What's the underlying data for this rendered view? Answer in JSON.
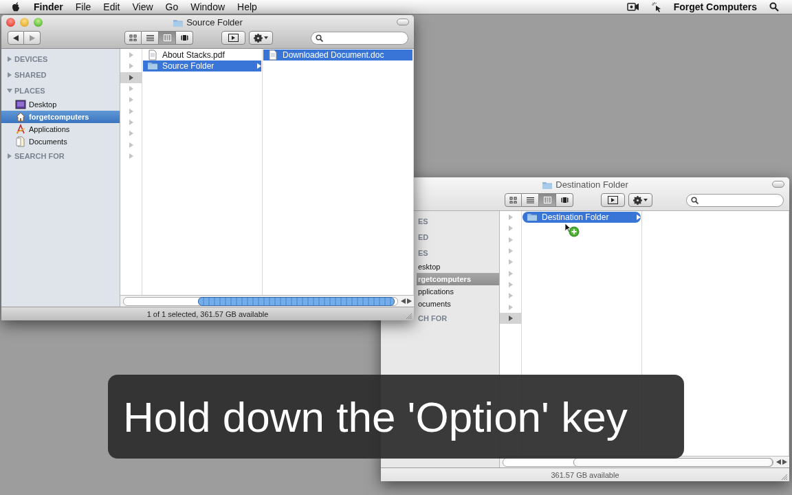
{
  "menu_bar": {
    "app": "Finder",
    "menus": [
      "File",
      "Edit",
      "View",
      "Go",
      "Window",
      "Help"
    ],
    "user": "Forget Computers"
  },
  "windows": [
    {
      "title": "Source Folder",
      "active": true,
      "window_controls": true,
      "sidebar": {
        "sections": [
          {
            "label": "DEVICES",
            "expanded": false
          },
          {
            "label": "SHARED",
            "expanded": false
          },
          {
            "label": "PLACES",
            "expanded": true,
            "items": [
              {
                "label": "Desktop",
                "selected": false
              },
              {
                "label": "forgetcomputers",
                "selected": true
              },
              {
                "label": "Applications",
                "selected": false
              },
              {
                "label": "Documents",
                "selected": false
              }
            ]
          },
          {
            "label": "SEARCH FOR",
            "expanded": false
          }
        ]
      },
      "arrow_column": [
        {
          "selected": false
        },
        {
          "selected": false
        },
        {
          "selected": true
        },
        {
          "selected": false
        },
        {
          "selected": false
        },
        {
          "selected": false
        },
        {
          "selected": false
        },
        {
          "selected": false
        },
        {
          "selected": false
        },
        {
          "selected": false
        }
      ],
      "columns": [
        {
          "items": [
            {
              "name": "About Stacks.pdf",
              "kind": "document",
              "selected": false
            },
            {
              "name": "Source Folder",
              "kind": "folder",
              "selected": true
            }
          ]
        },
        {
          "items": [
            {
              "name": "Downloaded Document.doc",
              "kind": "document",
              "selected": true
            }
          ]
        }
      ],
      "status": "1 of 1 selected, 361.57 GB available"
    },
    {
      "title": "Destination Folder",
      "active": false,
      "sidebar": {
        "partial": true,
        "sections": [
          {
            "label": "ES"
          },
          {
            "label": "ED"
          },
          {
            "label": "ES",
            "items": [
              {
                "label": "esktop",
                "selected": false
              },
              {
                "label": "rgetcomputers",
                "selected": true
              },
              {
                "label": "pplications",
                "selected": false
              },
              {
                "label": "ocuments",
                "selected": false
              }
            ]
          },
          {
            "label": "CH FOR"
          }
        ]
      },
      "arrow_column": [
        {
          "selected": false
        },
        {
          "selected": false
        },
        {
          "selected": false
        },
        {
          "selected": false
        },
        {
          "selected": false
        },
        {
          "selected": false
        },
        {
          "selected": false
        },
        {
          "selected": false
        },
        {
          "selected": false
        },
        {
          "selected": true
        }
      ],
      "columns": [
        {
          "items": [
            {
              "name": "Destination Folder",
              "kind": "folder",
              "selected": true,
              "drop_copy": true
            }
          ]
        },
        {}
      ],
      "status": "361.57 GB available"
    }
  ],
  "caption": "Hold down the 'Option' key"
}
